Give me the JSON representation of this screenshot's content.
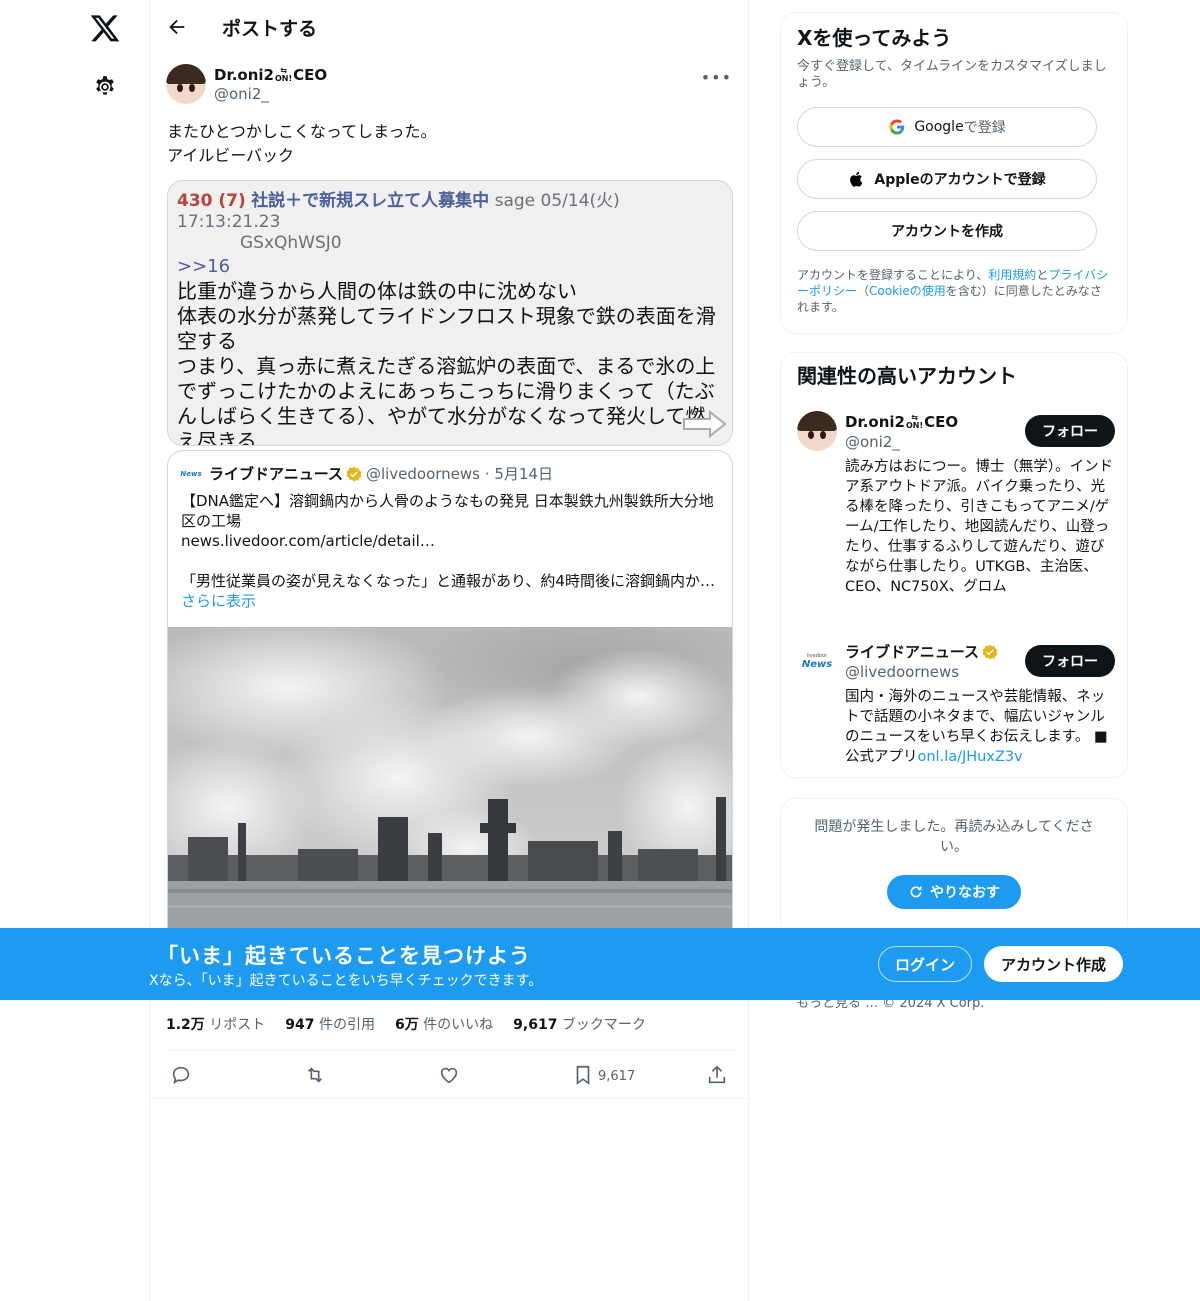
{
  "header": {
    "title": "ポストする"
  },
  "post": {
    "author_name": "Dr.oni2",
    "author_badge": "ON!",
    "author_suffix": "CEO",
    "author_handle": "@oni2_",
    "text_line1": "またひとつかしこくなってしまった。",
    "text_line2": "アイルビーバック",
    "screenshot": {
      "number": "430 (7)",
      "name": "社説＋で新規スレ立て人募集中",
      "meta": "sage 05/14(火) 17:13:21.23",
      "id": "GSxQhWSJ0",
      "ref": ">>16",
      "lines": [
        "比重が違うから人間の体は鉄の中に沈めない",
        "体表の水分が蒸発してライドンフロスト現象で鉄の表面を滑空する",
        "つまり、真っ赤に煮えたぎる溶鉱炉の表面で、まるで氷の上でずっこけたかのよえにあっちこっちに滑りまくって（たぶんしばらく生きてる）、やがて水分がなくなって発火して燃え尽きる"
      ]
    },
    "quote": {
      "logo_text": "News",
      "name": "ライブドアニュース",
      "handle": "@livedoornews",
      "date": "5月14日",
      "title": "【DNA鑑定へ】溶鋼鍋内から人骨のようなもの発見 日本製鉄九州製鉄所大分地区の工場",
      "link": "news.livedoor.com/article/detail…",
      "excerpt": "「男性従業員の姿が見えなくなった」と通報があり、約4時間後に溶鋼鍋内か…",
      "show_more": "さらに表示"
    },
    "stats": [
      {
        "value": "1.2万",
        "label": "リポスト"
      },
      {
        "value": "947",
        "label": "件の引用"
      },
      {
        "value": "6万",
        "label": "件のいいね"
      },
      {
        "value": "9,617",
        "label": "ブックマーク"
      }
    ],
    "bookmark_count": "9,617"
  },
  "signup": {
    "title": "Xを使ってみよう",
    "subtitle": "今すぐ登録して、タイムラインをカスタマイズしましょう。",
    "google_prefix": "Google",
    "google_suffix": " で登録",
    "apple_label": "Appleのアカウントで登録",
    "create_label": "アカウントを作成",
    "legal_1": "アカウントを登録することにより、",
    "legal_terms": "利用規約",
    "legal_2": "と",
    "legal_privacy": "プライバシーポリシー",
    "legal_3": "（",
    "legal_cookie": "Cookieの使用",
    "legal_4": "を含む）に同意したとみなされます。"
  },
  "related": {
    "title": "関連性の高いアカウント",
    "follow_label": "フォロー",
    "accounts": [
      {
        "name": "Dr.oni2",
        "badge": "ON!",
        "suffix": "CEO",
        "handle": "@oni2_",
        "bio": "読み方はおにつー。博士（無学）。インドア系アウトドア派。バイク乗ったり、光る棒を降ったり、引きこもってアニメ/ゲーム/工作したり、地図読んだり、山登ったり、仕事するふりして遊んだり、遊びながら仕事したり。UTKGB、主治医、CEO、NC750X、グロム"
      },
      {
        "name": "ライブドアニュース",
        "handle": "@livedoornews",
        "logo_text": "News",
        "logo_small": "livedoor",
        "bio": "国内・海外のニュースや芸能情報、ネットで話題の小ネタまで、幅広いジャンルのニュースをいち早くお伝えします。 ■公式アプリ",
        "bio_link": "onl.la/JHuxZ3v"
      }
    ]
  },
  "error": {
    "message": "問題が発生しました。再読み込みしてください。",
    "retry_label": "やりなおす"
  },
  "footer": {
    "text": "もっと見る …   © 2024 X Corp."
  },
  "banner": {
    "title": "「いま」起きていることを見つけよう",
    "subtitle": "Xなら、「いま」起きていることをいち早くチェックできます。",
    "login_label": "ログイン",
    "signup_label": "アカウント作成"
  },
  "colors": {
    "accent": "#1d9bf0",
    "text": "#0f1419",
    "muted": "#536471",
    "border": "#cfd9de"
  }
}
